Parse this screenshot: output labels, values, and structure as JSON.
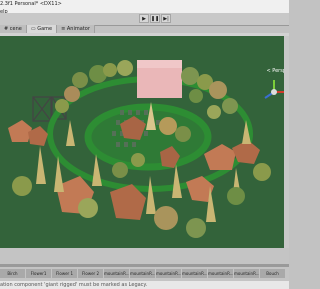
{
  "window": {
    "title": "2.3f1 Personal* <DX11>",
    "menu_partial": "elp"
  },
  "toolbar": {
    "play_icons": [
      "play-icon",
      "pause-icon",
      "step-icon"
    ]
  },
  "tabs": [
    {
      "label": "cene",
      "icon": "grid-icon",
      "active": false
    },
    {
      "label": "Game",
      "icon": "game-icon",
      "active": true
    },
    {
      "label": "Animator",
      "icon": "animator-icon",
      "active": false
    }
  ],
  "gizmo": {
    "label": "< Persp"
  },
  "assets": [
    "Birch",
    "Flower1",
    "Flower 1",
    "Flower 2",
    "mountainR...",
    "mountainR...",
    "mountainR...",
    "mountainR...",
    "mountainR...",
    "mountainR...",
    "Bouch",
    "gizzibo",
    "Stone 1"
  ],
  "status": {
    "message": "ation component 'giant rigged' must be marked as Legacy."
  },
  "colors": {
    "ground": "#33633a",
    "path": "#2d8d33",
    "house": "#eab7b8",
    "rock": "#c27a55",
    "tree": "#8a9a4b"
  }
}
